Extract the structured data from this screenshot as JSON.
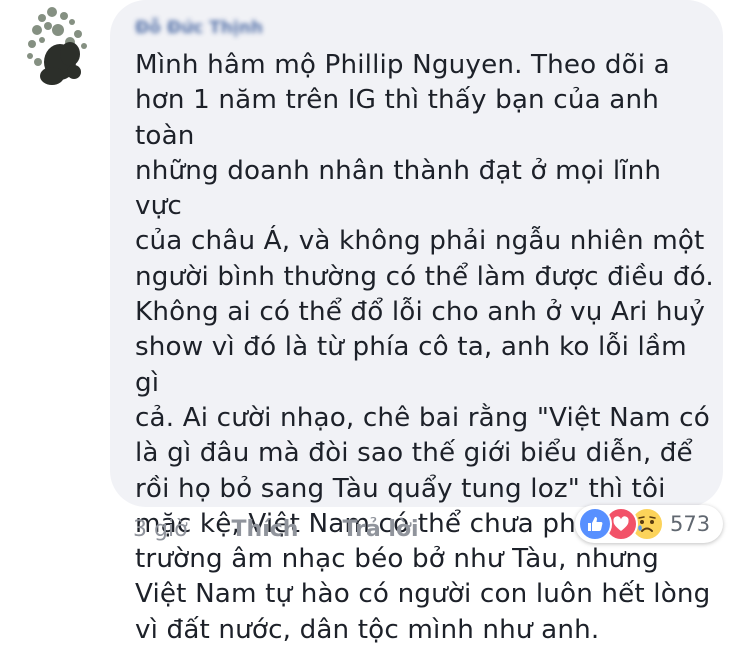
{
  "comment": {
    "author": "Đỗ Đức Thịnh",
    "text": "Mình hâm mộ Phillip Nguyen. Theo dõi a\nhơn 1 năm trên IG thì thấy bạn của anh toàn\nnhững doanh nhân thành đạt ở mọi lĩnh vực\ncủa châu Á, và không phải ngẫu nhiên một\nngười bình thường có thể làm được điều đó.\nKhông ai có thể đổ lỗi cho anh ở vụ Ari huỷ\nshow vì đó là từ phía cô ta, anh ko lỗi lầm gì\ncả. Ai cười nhạo, chê bai rằng \"Việt Nam có\nlà gì đâu mà đòi sao thế giới biểu diễn, để\nrồi họ bỏ sang Tàu quẩy tung loz\" thì tôi\nmặc kệ, Việt Nam có thể chưa phải là thị\ntrường âm nhạc béo bở như Tàu, nhưng\nViệt Nam tự hào có người con luôn hết lòng\nvì đất nước, dân tộc mình như anh."
  },
  "actions": {
    "timestamp": "3 giờ",
    "like_label": "Thích",
    "reply_label": "Trả lời"
  },
  "reactions": {
    "icons": [
      "like-icon",
      "love-icon",
      "sad-icon"
    ],
    "count": "573"
  },
  "colors": {
    "bubble_bg": "#f1f2f6",
    "author": "#365899",
    "text": "#1d2129",
    "meta": "#90949c",
    "like": "#5890ff",
    "love": "#f25268",
    "sad": "#fcd35a"
  }
}
